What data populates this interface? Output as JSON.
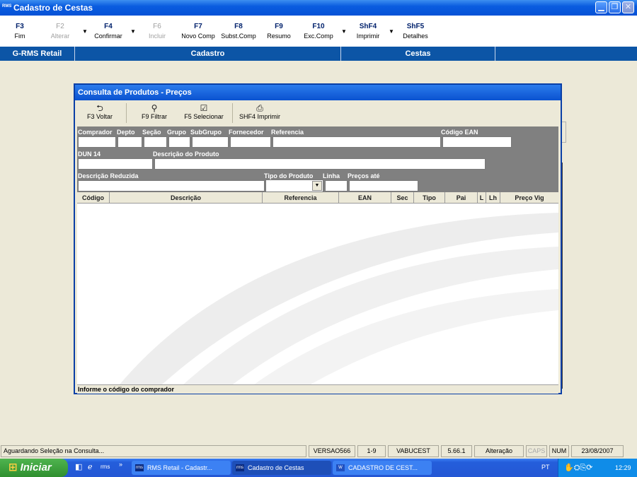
{
  "window": {
    "app_icon": "RMS",
    "title": "Cadastro de Cestas",
    "buttons": [
      "minimize",
      "maximize",
      "close"
    ]
  },
  "function_keys": [
    {
      "key": "F3",
      "label": "Fim",
      "enabled": true
    },
    {
      "key": "F2",
      "label": "Alterar",
      "enabled": false
    },
    {
      "key": "F4",
      "label": "Confirmar",
      "enabled": true
    },
    {
      "key": "F6",
      "label": "Incluir",
      "enabled": false
    },
    {
      "key": "F7",
      "label": "Novo Comp",
      "enabled": true
    },
    {
      "key": "F8",
      "label": "Subst.Comp",
      "enabled": true
    },
    {
      "key": "F9",
      "label": "Resumo",
      "enabled": true
    },
    {
      "key": "F10",
      "label": "Exc.Comp",
      "enabled": true
    },
    {
      "key": "ShF4",
      "label": "Imprimir",
      "enabled": true
    },
    {
      "key": "ShF5",
      "label": "Detalhes",
      "enabled": true
    }
  ],
  "navbar": {
    "app": "G-RMS Retail",
    "module": "Cadastro",
    "screen": "Cestas"
  },
  "dialog": {
    "title": "Consulta de Produtos - Preços",
    "toolbar": {
      "voltar": "F3 Voltar",
      "filtrar": "F9 Filtrar",
      "selecionar": "F5 Selecionar",
      "imprimir": "SHF4 Imprimir"
    },
    "filters": {
      "comprador": "Comprador",
      "depto": "Depto",
      "secao": "Seção",
      "grupo": "Grupo",
      "subgrupo": "SubGrupo",
      "fornecedor": "Fornecedor",
      "referencia": "Referencia",
      "codigo_ean": "Código EAN",
      "dun14": "DUN 14",
      "descricao_produto": "Descrição do Produto",
      "descricao_reduzida": "Descrição Reduzida",
      "tipo_produto": "Tipo do Produto",
      "linha": "Linha",
      "precos_ate": "Preços até"
    },
    "grid_columns": [
      "Código",
      "Descrição",
      "Referencia",
      "EAN",
      "Sec",
      "Tipo",
      "Pai",
      "L",
      "Lh",
      "Preço Vig"
    ],
    "status_message": "Informe o código do comprador"
  },
  "statusbar": {
    "message": "Aguardando Seleção na Consulta...",
    "version": "VERSAO566",
    "page": "1-9",
    "program": "VABUCEST",
    "build": "5.66.1",
    "mode": "Alteração",
    "caps": "CAPS",
    "num": "NUM",
    "date": "23/08/2007"
  },
  "taskbar": {
    "start": "Iniciar",
    "tasks": [
      "RMS Retail - Cadastr...",
      "Cadastro de Cestas",
      "CADASTRO DE CEST..."
    ],
    "language": "PT",
    "time": "12:29"
  },
  "colors": {
    "title_bar": "#0a5ce0",
    "nav_bar": "#0c55a6",
    "filter_panel": "#808080",
    "desktop": "#ece9d8"
  }
}
